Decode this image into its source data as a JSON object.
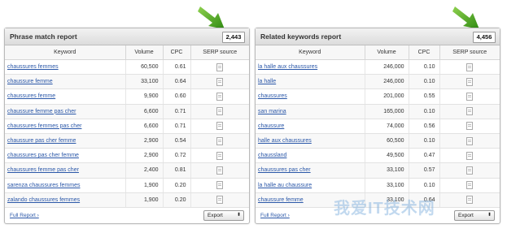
{
  "left": {
    "title": "Phrase match report",
    "count": "2,443",
    "headers": [
      "Keyword",
      "Volume",
      "CPC",
      "SERP source"
    ],
    "rows": [
      {
        "kw": "chaussures femmes",
        "vol": "60,500",
        "cpc": "0.61"
      },
      {
        "kw": "chaussure femme",
        "vol": "33,100",
        "cpc": "0.64"
      },
      {
        "kw": "chaussures femme",
        "vol": "9,900",
        "cpc": "0.60"
      },
      {
        "kw": "chaussure femme pas cher",
        "vol": "6,600",
        "cpc": "0.71"
      },
      {
        "kw": "chaussures femmes pas cher",
        "vol": "6,600",
        "cpc": "0.71"
      },
      {
        "kw": "chaussure pas cher femme",
        "vol": "2,900",
        "cpc": "0.54"
      },
      {
        "kw": "chaussures pas cher femme",
        "vol": "2,900",
        "cpc": "0.72"
      },
      {
        "kw": "chaussures femme pas cher",
        "vol": "2,400",
        "cpc": "0.81"
      },
      {
        "kw": "sarenza chaussures femmes",
        "vol": "1,900",
        "cpc": "0.20"
      },
      {
        "kw": "zalando chaussures femmes",
        "vol": "1,900",
        "cpc": "0.20"
      }
    ],
    "full_report": "Full Report ›",
    "export": "Export"
  },
  "right": {
    "title": "Related keywords report",
    "count": "4,456",
    "headers": [
      "Keyword",
      "Volume",
      "CPC",
      "SERP source"
    ],
    "rows": [
      {
        "kw": "la halle aux chaussures",
        "vol": "246,000",
        "cpc": "0.10"
      },
      {
        "kw": "la halle",
        "vol": "246,000",
        "cpc": "0.10"
      },
      {
        "kw": "chaussures",
        "vol": "201,000",
        "cpc": "0.55"
      },
      {
        "kw": "san marina",
        "vol": "165,000",
        "cpc": "0.10"
      },
      {
        "kw": "chaussure",
        "vol": "74,000",
        "cpc": "0.56"
      },
      {
        "kw": "halle aux chaussures",
        "vol": "60,500",
        "cpc": "0.10"
      },
      {
        "kw": "chaussland",
        "vol": "49,500",
        "cpc": "0.47"
      },
      {
        "kw": "chaussures pas cher",
        "vol": "33,100",
        "cpc": "0.57"
      },
      {
        "kw": "la halle au chaussure",
        "vol": "33,100",
        "cpc": "0.10"
      },
      {
        "kw": "chaussure femme",
        "vol": "33,100",
        "cpc": "0.64"
      }
    ],
    "full_report": "Full Report ›",
    "export": "Export"
  },
  "watermark": "我爱IT技术网",
  "colors": {
    "link": "#2a57a8",
    "arrow": "#3d9a1f"
  },
  "icons": {
    "serp": "document-icon",
    "pointer": "green-arrow-icon"
  }
}
